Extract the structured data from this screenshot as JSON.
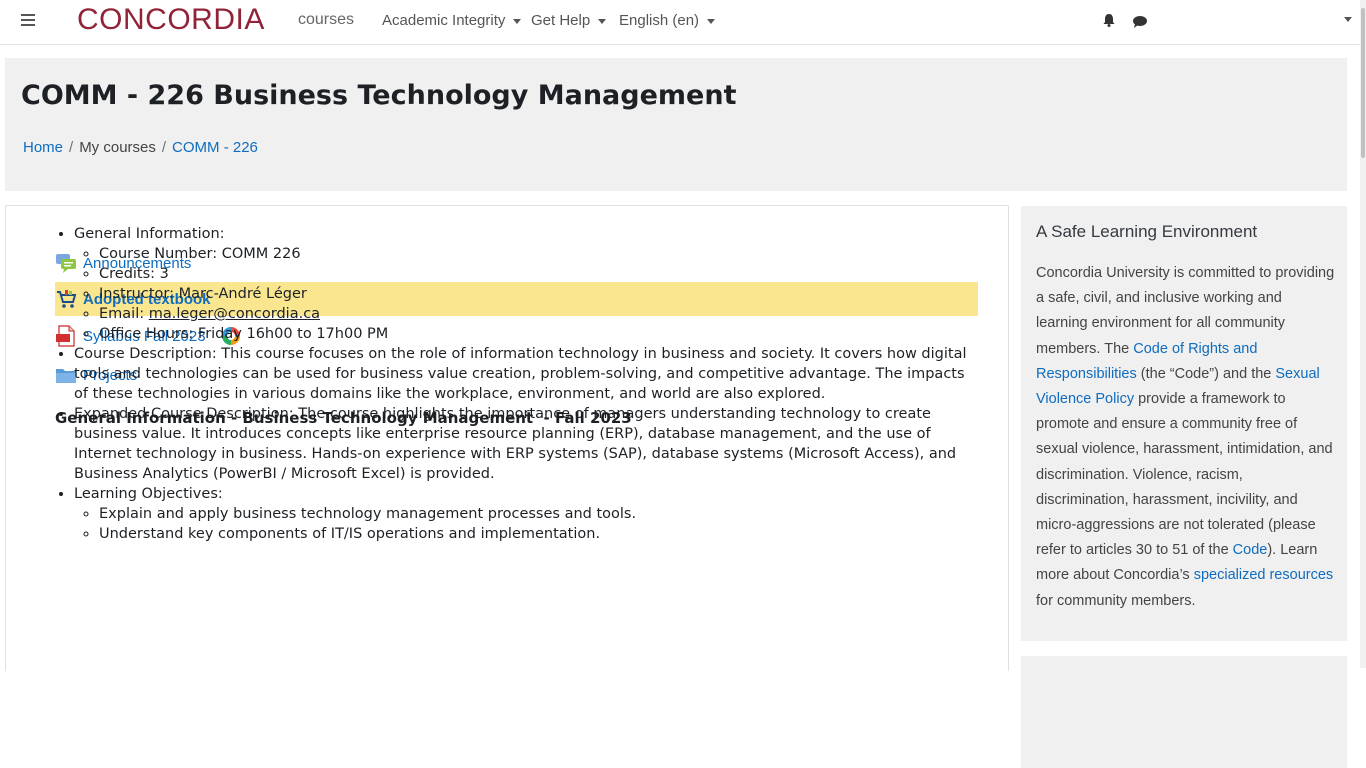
{
  "navbar": {
    "brand": "CONCORDIA",
    "brand_sub": "courses",
    "menus": [
      {
        "label": "Academic Integrity"
      },
      {
        "label": "Get Help"
      },
      {
        "label": "English (en)"
      }
    ],
    "icons": [
      "menu-icon",
      "bell-icon",
      "chat-icon",
      "chevron-down-icon"
    ],
    "brand_color": "#912338"
  },
  "header": {
    "title": "COMM - 226 Business Technology Management",
    "breadcrumb": [
      "Home",
      "My courses",
      "COMM - 226"
    ]
  },
  "activities": [
    {
      "label": "Announcements",
      "icon": "forum-icon"
    },
    {
      "label": "Adopted textbook",
      "icon": "cart-icon"
    },
    {
      "label": "Syllabus Fall 2023",
      "icon": "pdf-icon"
    },
    {
      "label": "Projects",
      "icon": "folder-icon"
    }
  ],
  "highlight_color": "#f9e68f",
  "content": {
    "heading": "General Information - Business Technology Management  - Fall 2023",
    "general_label": "General Information:",
    "course_number": "Course Number: COMM 226",
    "credits": "Credits: 3",
    "instructor": "Instructor: Marc-André Léger",
    "email_label": "Email: ",
    "email": "ma.leger@concordia.ca",
    "office_hours": "Office Hours: Friday 16h00 to 17h00 PM",
    "course_description": "Course Description: This course focuses on the role of information technology in business and society. It covers how digital tools and technologies can be used for business value creation, problem-solving, and competitive advantage. The impacts of these technologies in various domains like the workplace, environment, and world are also explored.",
    "expanded_description": "Expanded Course Description: The course highlights the importance of managers understanding technology to create business value. It introduces concepts like enterprise resource planning (ERP), database management, and the use of Internet technology in business. Hands-on experience with ERP systems (SAP), database systems (Microsoft Access), and Business Analytics (PowerBI / Microsoft Excel) is provided.",
    "objectives_label": "Learning Objectives:",
    "objectives": [
      "Explain and apply business technology management processes and tools.",
      "Understand key components of IT/IS operations and implementation."
    ]
  },
  "sidebar": {
    "title": "A Safe Learning Environment",
    "p1": "Concordia University is committed to providing a safe, civil, and inclusive working and learning environment for all community members. The ",
    "link1": "Code of Rights and Responsibilities",
    "p2": " (the “Code”) and the ",
    "link2": "Sexual Violence Policy",
    "p3": " provide a framework to promote and ensure a community free of sexual violence, harassment, intimidation, and discrimination. Violence, racism, discrimination, harassment, incivility, and micro-aggressions are not tolerated (please refer to articles 30 to 51 of the ",
    "link3": "Code",
    "p4": "). Learn more about Concordia’s ",
    "link4": "specialized resources",
    "p5": " for community members."
  }
}
